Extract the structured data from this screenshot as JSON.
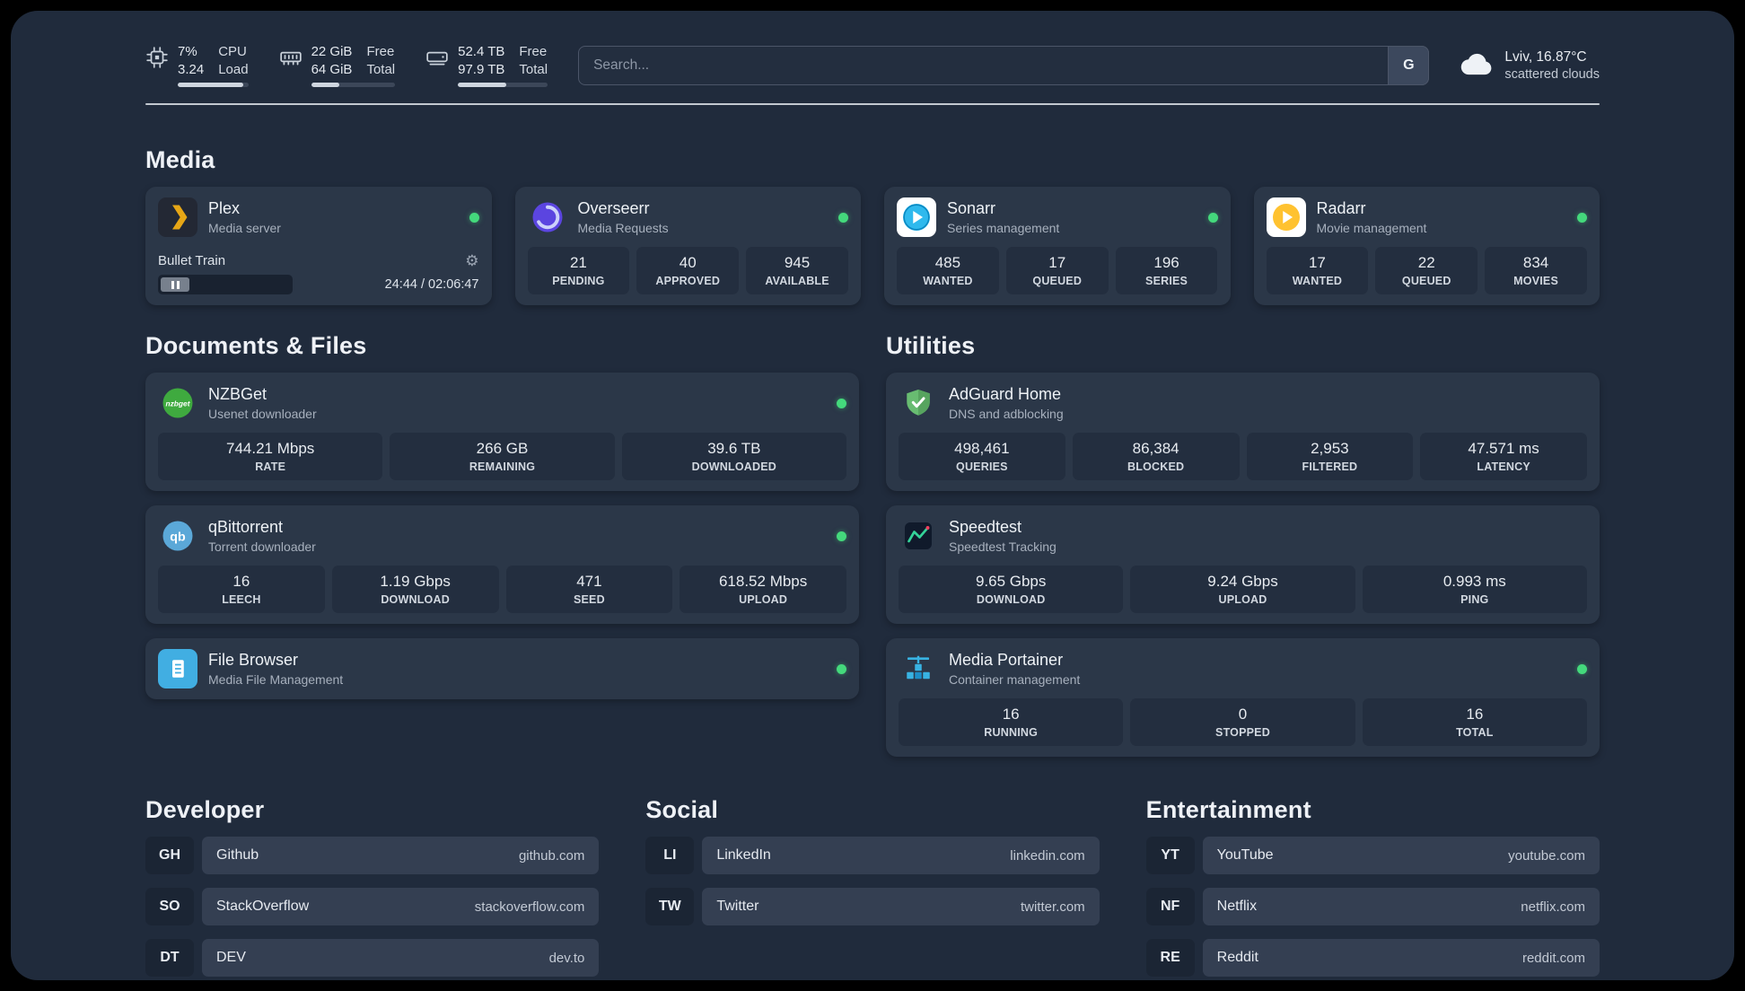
{
  "topbar": {
    "cpu": {
      "percent": "7%",
      "load": "3.24",
      "label_top": "CPU",
      "label_bottom": "Load"
    },
    "memory": {
      "free": "22 GiB",
      "total": "64 GiB",
      "label_top": "Free",
      "label_bottom": "Total"
    },
    "disk": {
      "free": "52.4 TB",
      "total": "97.9 TB",
      "label_top": "Free",
      "label_bottom": "Total"
    },
    "search": {
      "placeholder": "Search...",
      "button_label": "G"
    },
    "weather": {
      "location": "Lviv, 16.87°C",
      "condition": "scattered clouds"
    }
  },
  "sections": {
    "media": "Media",
    "documents": "Documents & Files",
    "utilities": "Utilities",
    "developer": "Developer",
    "social": "Social",
    "entertainment": "Entertainment"
  },
  "media": {
    "plex": {
      "name": "Plex",
      "desc": "Media server",
      "now_playing": "Bullet Train",
      "time": "24:44 / 02:06:47"
    },
    "overseerr": {
      "name": "Overseerr",
      "desc": "Media Requests",
      "stats": [
        {
          "value": "21",
          "label": "PENDING"
        },
        {
          "value": "40",
          "label": "APPROVED"
        },
        {
          "value": "945",
          "label": "AVAILABLE"
        }
      ]
    },
    "sonarr": {
      "name": "Sonarr",
      "desc": "Series management",
      "stats": [
        {
          "value": "485",
          "label": "WANTED"
        },
        {
          "value": "17",
          "label": "QUEUED"
        },
        {
          "value": "196",
          "label": "SERIES"
        }
      ]
    },
    "radarr": {
      "name": "Radarr",
      "desc": "Movie management",
      "stats": [
        {
          "value": "17",
          "label": "WANTED"
        },
        {
          "value": "22",
          "label": "QUEUED"
        },
        {
          "value": "834",
          "label": "MOVIES"
        }
      ]
    }
  },
  "documents": {
    "nzbget": {
      "name": "NZBGet",
      "desc": "Usenet downloader",
      "stats": [
        {
          "value": "744.21 Mbps",
          "label": "RATE"
        },
        {
          "value": "266 GB",
          "label": "REMAINING"
        },
        {
          "value": "39.6 TB",
          "label": "DOWNLOADED"
        }
      ]
    },
    "qbittorrent": {
      "name": "qBittorrent",
      "desc": "Torrent downloader",
      "stats": [
        {
          "value": "16",
          "label": "LEECH"
        },
        {
          "value": "1.19 Gbps",
          "label": "DOWNLOAD"
        },
        {
          "value": "471",
          "label": "SEED"
        },
        {
          "value": "618.52 Mbps",
          "label": "UPLOAD"
        }
      ]
    },
    "filebrowser": {
      "name": "File Browser",
      "desc": "Media File Management"
    }
  },
  "utilities": {
    "adguard": {
      "name": "AdGuard Home",
      "desc": "DNS and adblocking",
      "stats": [
        {
          "value": "498,461",
          "label": "QUERIES"
        },
        {
          "value": "86,384",
          "label": "BLOCKED"
        },
        {
          "value": "2,953",
          "label": "FILTERED"
        },
        {
          "value": "47.571 ms",
          "label": "LATENCY"
        }
      ]
    },
    "speedtest": {
      "name": "Speedtest",
      "desc": "Speedtest Tracking",
      "stats": [
        {
          "value": "9.65 Gbps",
          "label": "DOWNLOAD"
        },
        {
          "value": "9.24 Gbps",
          "label": "UPLOAD"
        },
        {
          "value": "0.993 ms",
          "label": "PING"
        }
      ]
    },
    "portainer": {
      "name": "Media Portainer",
      "desc": "Container management",
      "stats": [
        {
          "value": "16",
          "label": "RUNNING"
        },
        {
          "value": "0",
          "label": "STOPPED"
        },
        {
          "value": "16",
          "label": "TOTAL"
        }
      ]
    }
  },
  "bookmarks": {
    "developer": [
      {
        "abbr": "GH",
        "name": "Github",
        "url": "github.com"
      },
      {
        "abbr": "SO",
        "name": "StackOverflow",
        "url": "stackoverflow.com"
      },
      {
        "abbr": "DT",
        "name": "DEV",
        "url": "dev.to"
      }
    ],
    "social": [
      {
        "abbr": "LI",
        "name": "LinkedIn",
        "url": "linkedin.com"
      },
      {
        "abbr": "TW",
        "name": "Twitter",
        "url": "twitter.com"
      }
    ],
    "entertainment": [
      {
        "abbr": "YT",
        "name": "YouTube",
        "url": "youtube.com"
      },
      {
        "abbr": "NF",
        "name": "Netflix",
        "url": "netflix.com"
      },
      {
        "abbr": "RE",
        "name": "Reddit",
        "url": "reddit.com"
      }
    ]
  },
  "colors": {
    "status_online": "#44d97c",
    "page_bg": "#202b3c",
    "card_bg": "#2b3748"
  }
}
